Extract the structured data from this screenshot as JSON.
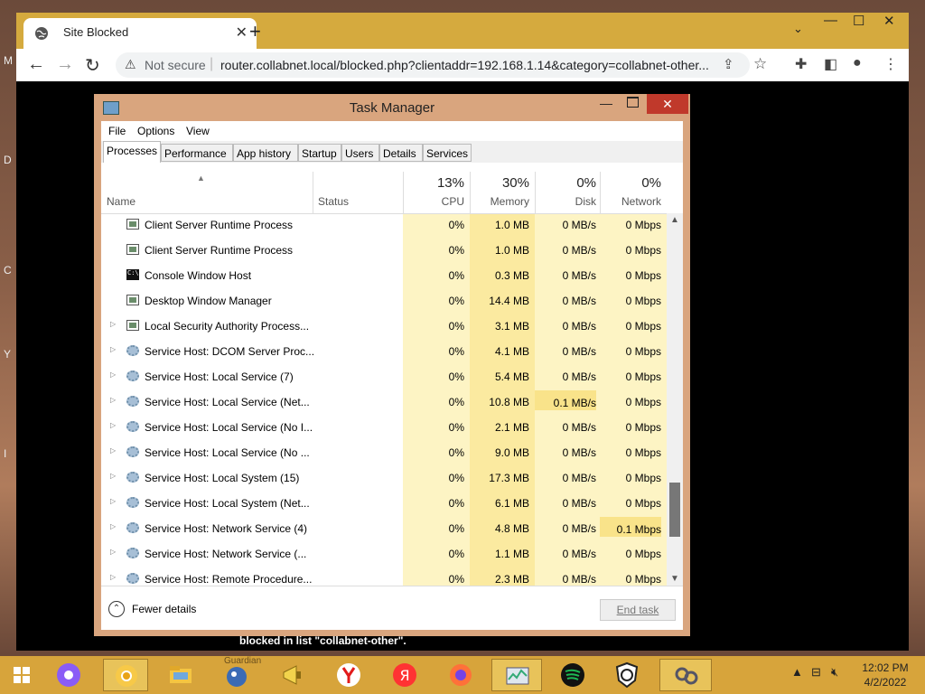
{
  "browser": {
    "tab_title": "Site Blocked",
    "not_secure": "Not secure",
    "url": "router.collabnet.local/blocked.php?clientaddr=192.168.1.14&category=collabnet-other...",
    "page_text": "blocked in list \"collabnet-other\"."
  },
  "taskmanager": {
    "title": "Task Manager",
    "menu": [
      "File",
      "Options",
      "View"
    ],
    "tabs": [
      "Processes",
      "Performance",
      "App history",
      "Startup",
      "Users",
      "Details",
      "Services"
    ],
    "columns": {
      "name": "Name",
      "status": "Status",
      "cpu_pct": "13%",
      "cpu": "CPU",
      "mem_pct": "30%",
      "mem": "Memory",
      "disk_pct": "0%",
      "disk": "Disk",
      "net_pct": "0%",
      "net": "Network"
    },
    "rows": [
      {
        "name": "Client Server Runtime Process",
        "cpu": "0%",
        "mem": "1.0 MB",
        "disk": "0 MB/s",
        "net": "0 Mbps"
      },
      {
        "name": "Client Server Runtime Process",
        "cpu": "0%",
        "mem": "1.0 MB",
        "disk": "0 MB/s",
        "net": "0 Mbps"
      },
      {
        "name": "Console Window Host",
        "cpu": "0%",
        "mem": "0.3 MB",
        "disk": "0 MB/s",
        "net": "0 Mbps"
      },
      {
        "name": "Desktop Window Manager",
        "cpu": "0%",
        "mem": "14.4 MB",
        "disk": "0 MB/s",
        "net": "0 Mbps"
      },
      {
        "name": "Local Security Authority Process...",
        "cpu": "0%",
        "mem": "3.1 MB",
        "disk": "0 MB/s",
        "net": "0 Mbps"
      },
      {
        "name": "Service Host: DCOM Server Proc...",
        "cpu": "0%",
        "mem": "4.1 MB",
        "disk": "0 MB/s",
        "net": "0 Mbps"
      },
      {
        "name": "Service Host: Local Service (7)",
        "cpu": "0%",
        "mem": "5.4 MB",
        "disk": "0 MB/s",
        "net": "0 Mbps"
      },
      {
        "name": "Service Host: Local Service (Net...",
        "cpu": "0%",
        "mem": "10.8 MB",
        "disk": "0.1 MB/s",
        "net": "0 Mbps"
      },
      {
        "name": "Service Host: Local Service (No I...",
        "cpu": "0%",
        "mem": "2.1 MB",
        "disk": "0 MB/s",
        "net": "0 Mbps"
      },
      {
        "name": "Service Host: Local Service (No ...",
        "cpu": "0%",
        "mem": "9.0 MB",
        "disk": "0 MB/s",
        "net": "0 Mbps"
      },
      {
        "name": "Service Host: Local System (15)",
        "cpu": "0%",
        "mem": "17.3 MB",
        "disk": "0 MB/s",
        "net": "0 Mbps"
      },
      {
        "name": "Service Host: Local System (Net...",
        "cpu": "0%",
        "mem": "6.1 MB",
        "disk": "0 MB/s",
        "net": "0 Mbps"
      },
      {
        "name": "Service Host: Network Service (4)",
        "cpu": "0%",
        "mem": "4.8 MB",
        "disk": "0 MB/s",
        "net": "0.1 Mbps"
      },
      {
        "name": "Service Host: Network Service (...",
        "cpu": "0%",
        "mem": "1.1 MB",
        "disk": "0 MB/s",
        "net": "0 Mbps"
      },
      {
        "name": "Service Host: Remote Procedure...",
        "cpu": "0%",
        "mem": "2.3 MB",
        "disk": "0 MB/s",
        "net": "0 Mbps"
      }
    ],
    "fewer_details": "Fewer details",
    "end_task": "End task"
  },
  "taskbar": {
    "guardian_label": "Guardian",
    "clock_time": "12:02 PM",
    "clock_date": "4/2/2022"
  },
  "colors": {
    "accent_gold": "#d7a43b",
    "tm_frame": "#d9a57e",
    "close_red": "#c0392b",
    "cpu_shade": "#fdf4c4",
    "mem_shade": "#fbeaa0",
    "highlight_shade": "#f9e38a"
  },
  "icons": {
    "tab": "globe-icon",
    "warning": "warning-icon",
    "processes": [
      "app-window-icon",
      "console-icon",
      "gear-icon"
    ]
  }
}
